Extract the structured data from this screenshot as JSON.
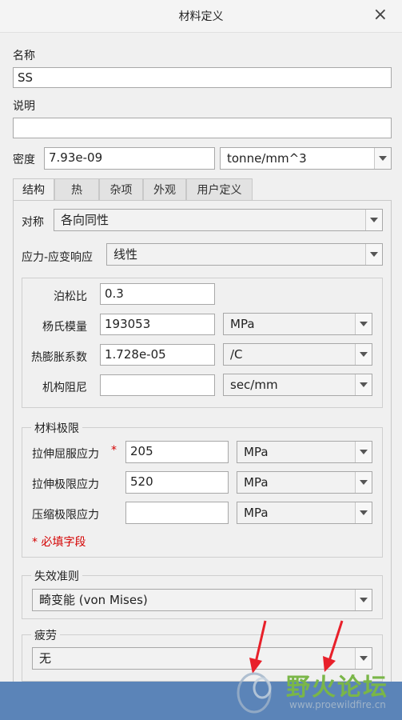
{
  "title": "材料定义",
  "name_label": "名称",
  "name_value": "SS",
  "desc_label": "说明",
  "desc_value": "",
  "density_label": "密度",
  "density_value": "7.93e-09",
  "density_unit": "tonne/mm^3",
  "tabs": [
    "结构",
    "热",
    "杂项",
    "外观",
    "用户定义"
  ],
  "active_tab": "结构",
  "symmetry_label": "对称",
  "symmetry_value": "各向同性",
  "stress_strain_label": "应力-应变响应",
  "stress_strain_value": "线性",
  "props": {
    "poisson_label": "泊松比",
    "poisson_value": "0.3",
    "young_label": "杨氏模量",
    "young_value": "193053",
    "young_unit": "MPa",
    "thermal_label": "热膨胀系数",
    "thermal_value": "1.728e-05",
    "thermal_unit": "/C",
    "damping_label": "机构阻尼",
    "damping_value": "",
    "damping_unit": "sec/mm"
  },
  "limits": {
    "title": "材料极限",
    "tensile_yield_label": "拉伸屈服应力",
    "tensile_yield_value": "205",
    "tensile_yield_unit": "MPa",
    "tensile_ultimate_label": "拉伸极限应力",
    "tensile_ultimate_value": "520",
    "tensile_ultimate_unit": "MPa",
    "compressive_label": "压缩极限应力",
    "compressive_value": "",
    "compressive_unit": "MPa",
    "required_marker": "*",
    "required_note": "* 必填字段"
  },
  "failure": {
    "title": "失效准则",
    "value": "畸变能 (von Mises)"
  },
  "fatigue": {
    "title": "疲劳",
    "value": "无"
  },
  "watermark": {
    "text": "野火论坛",
    "url": "www.proewildfire.cn"
  },
  "colors": {
    "taskbar": "#5b84b8",
    "required": "#d40000",
    "annotation_arrow": "#e8202a",
    "watermark_green": "#7ab648"
  }
}
